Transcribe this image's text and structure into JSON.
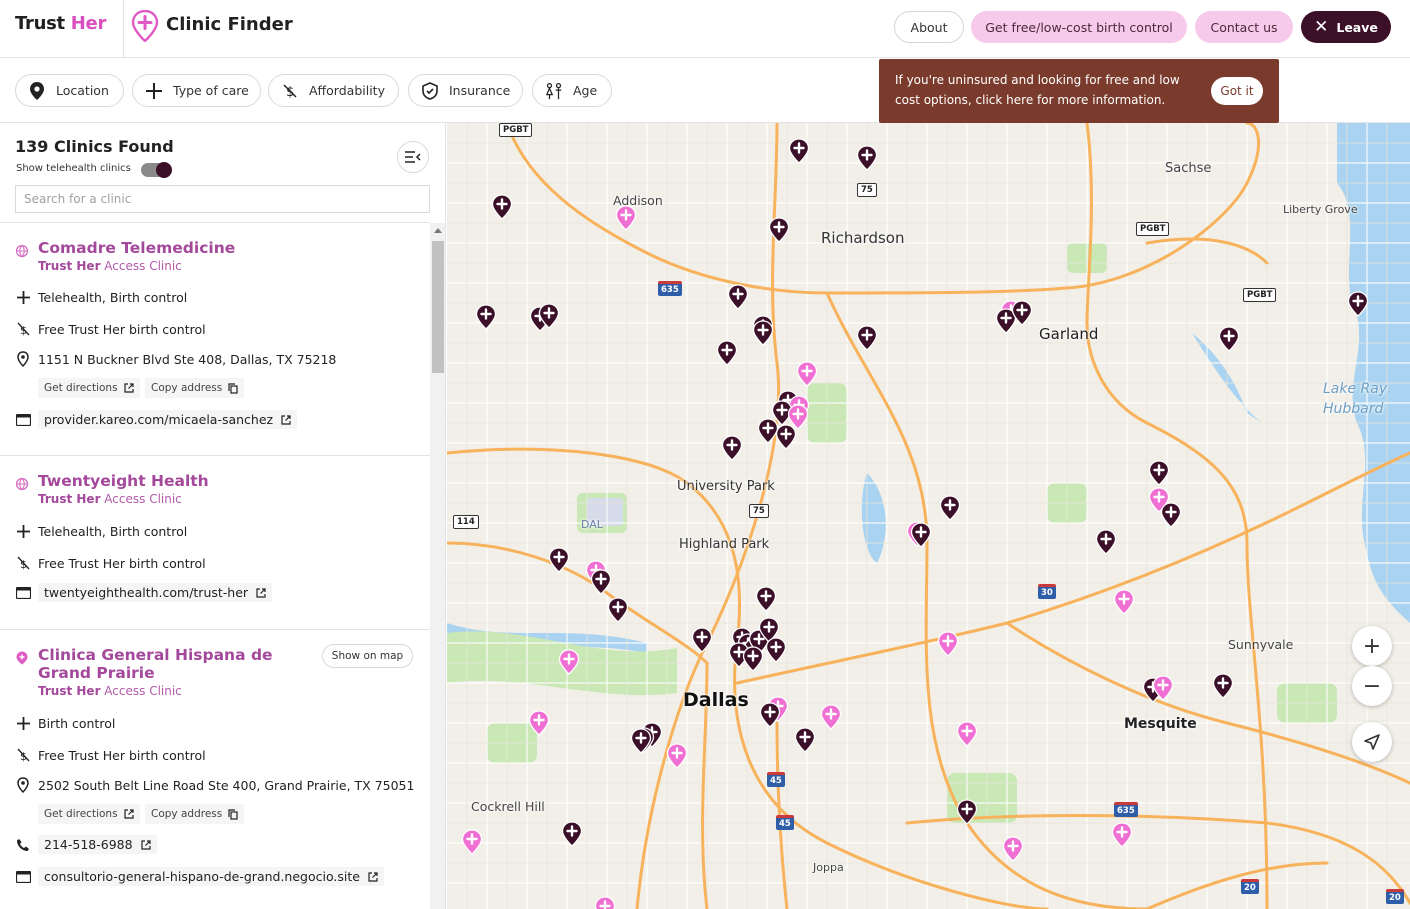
{
  "header": {
    "brand_trust": "Trust",
    "brand_her": "Her",
    "app_title": "Clinic Finder",
    "about": "About",
    "birth_control": "Get free/low-cost birth control",
    "contact": "Contact us",
    "leave": "Leave"
  },
  "filters": [
    {
      "label": "Location",
      "icon": "map-pin-icon"
    },
    {
      "label": "Type of care",
      "icon": "plus-icon"
    },
    {
      "label": "Affordability",
      "icon": "no-dollar-icon"
    },
    {
      "label": "Insurance",
      "icon": "shield-check-icon"
    },
    {
      "label": "Age",
      "icon": "people-icon"
    }
  ],
  "tooltip": {
    "text": "If you're uninsured and looking for free and low cost options, click here for more information.",
    "button": "Got it"
  },
  "sidebar": {
    "count": "139 Clinics Found",
    "telehealth_label": "Show telehealth clinics",
    "telehealth_on": true,
    "search_placeholder": "Search for a clinic"
  },
  "clinics": [
    {
      "name": "Comadre Telemedicine",
      "sub_brand": "Trust Her",
      "sub_rest": " Access Clinic",
      "services": "Telehealth, Birth control",
      "affordability": "Free Trust Her birth control",
      "address": "1151 N Buckner Blvd Ste 408, Dallas, TX 75218",
      "get_directions": "Get directions",
      "copy_address": "Copy address",
      "website": "provider.kareo.com/micaela-sanchez"
    },
    {
      "name": "Twentyeight Health",
      "sub_brand": "Trust Her",
      "sub_rest": " Access Clinic",
      "services": "Telehealth, Birth control",
      "affordability": "Free Trust Her birth control",
      "website": "twentyeighthealth.com/trust-her"
    },
    {
      "name": "Clinica General Hispana de Grand Prairie",
      "sub_brand": "Trust Her",
      "sub_rest": " Access Clinic",
      "show_on_map": "Show on map",
      "services": "Birth control",
      "affordability": "Free Trust Her birth control",
      "address": "2502 South Belt Line Road Ste 400, Grand Prairie, TX 75051",
      "get_directions": "Get directions",
      "copy_address": "Copy address",
      "phone": "214-518-6988",
      "website": "consultorio-general-hispano-de-grand.negocio.site"
    }
  ],
  "map": {
    "places": [
      "Sachse",
      "Addison",
      "Richardson",
      "Liberty Grove",
      "Garland",
      "Lake Ray",
      "Hubbard",
      "University Park",
      "DAL",
      "Highland Park",
      "Dallas",
      "Sunnyvale",
      "Mesquite",
      "Cockrell Hill",
      "Joppa"
    ],
    "shields": [
      "PGBT",
      "PGBT",
      "PGBT",
      "75",
      "635",
      "75",
      "114",
      "30",
      "45",
      "45",
      "635",
      "20",
      "20"
    ],
    "zoom_in": "+",
    "zoom_out": "−",
    "colors": {
      "dark_marker": "#3b1028",
      "pink_marker": "#f06fd3",
      "road": "#f7b25b",
      "water": "#a9d3f0",
      "park": "#c9e8b5"
    }
  }
}
